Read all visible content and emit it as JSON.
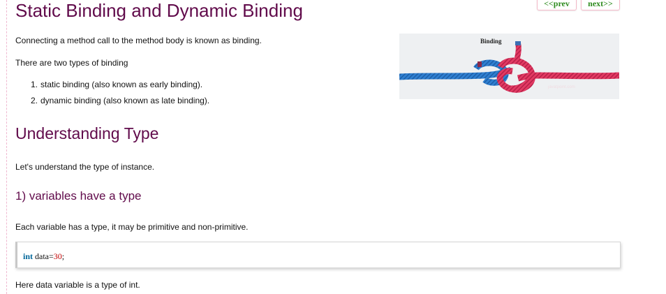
{
  "header": {
    "title": "Static Binding and Dynamic Binding",
    "prev_label": "<<prev",
    "next_label": "next>>"
  },
  "intro": {
    "definition": "Connecting a method call to the method body is known as binding.",
    "types_intro": "There are two types of binding",
    "types": [
      {
        "number": "1.",
        "text": "static binding (also known as early binding)."
      },
      {
        "number": "2.",
        "text": "dynamic binding (also known as late binding)."
      }
    ]
  },
  "hero_image": {
    "label": "Binding",
    "watermark": "javatpoint.com",
    "colors": {
      "left_rope": "#2f7fd0",
      "right_rope": "#e23a63",
      "background": "#eef0f2"
    }
  },
  "section": {
    "title": "Understanding Type",
    "intro": "Let's understand the type of instance."
  },
  "subsection": {
    "title": "1) variables have a type",
    "text": "Each variable has a type, it may be primitive and non-primitive.",
    "code": {
      "keyword": "int",
      "name": " data=",
      "value": "30",
      "end": ";"
    },
    "after_code": "Here data variable is a type of int."
  },
  "colors": {
    "heading": "#610b4b",
    "nav_text": "#2e8b1e",
    "nav_border": "#f4b8c8",
    "code_keyword": "#006699",
    "code_number": "#c00000"
  }
}
